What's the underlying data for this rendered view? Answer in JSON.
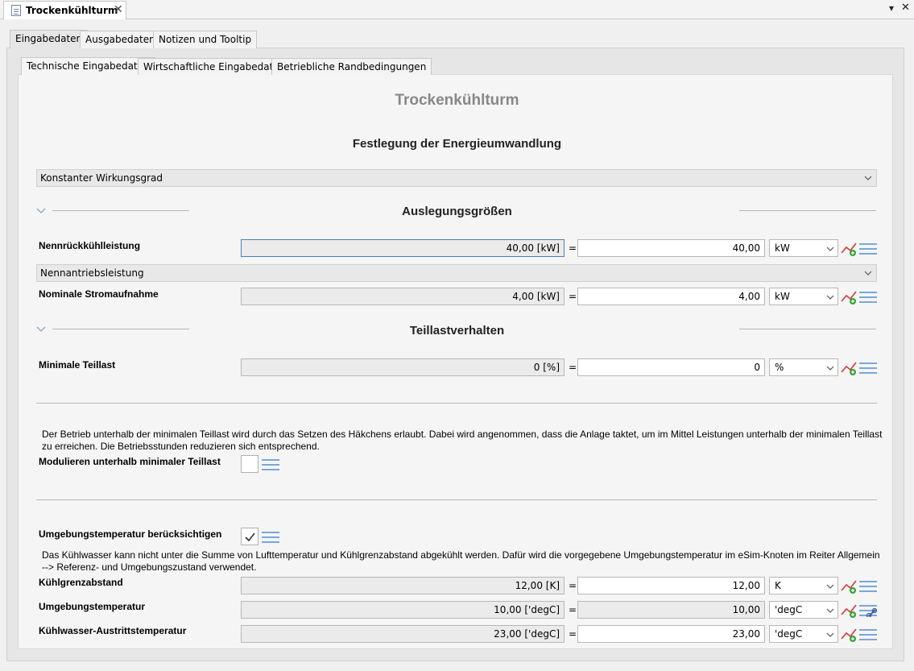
{
  "editor": {
    "tab_title": "Trockenkühlturm",
    "close_glyph": "✕",
    "menu_glyph": "▾",
    "win_close_glyph": "✕"
  },
  "tabs": [
    {
      "label": "Eingabedaten",
      "active": true
    },
    {
      "label": "Ausgabedaten",
      "active": false
    },
    {
      "label": "Notizen und Tooltip",
      "active": false
    }
  ],
  "subtabs": [
    {
      "label": "Technische Eingabedaten",
      "active": true
    },
    {
      "label": "Wirtschaftliche Eingabedaten",
      "active": false
    },
    {
      "label": "Betriebliche Randbedingungen",
      "active": false
    }
  ],
  "page_title": "Trockenkühlturm",
  "energy": {
    "heading": "Festlegung der Energieumwandlung",
    "mode_value": "Konstanter Wirkungsgrad"
  },
  "design": {
    "heading": "Auslegungsgrößen",
    "nenn_label": "Nennrückkühlleistung",
    "nenn_readonly": "40,00 [kW]",
    "nenn_value": "40,00",
    "nenn_unit": "kW",
    "drive_mode": "Nennantriebsleistung",
    "strom_label": "Nominale Stromaufnahme",
    "strom_readonly": "4,00 [kW]",
    "strom_value": "4,00",
    "strom_unit": "kW"
  },
  "partload": {
    "heading": "Teillastverhalten",
    "min_label": "Minimale Teillast",
    "min_readonly": "0 [%]",
    "min_value": "0",
    "min_unit": "%"
  },
  "modulate": {
    "description": "Der Betrieb unterhalb der minimalen Teillast wird durch das Setzen des Häkchens erlaubt. Dabei wird angenommen, dass die Anlage taktet, um im Mittel Leistungen unterhalb der minimalen Teillast zu erreichen. Die Betriebsstunden reduzieren sich entsprechend.",
    "label": "Modulieren unterhalb minimaler Teillast",
    "checked": false
  },
  "ambient": {
    "label": "Umgebungstemperatur berücksichtigen",
    "checked": true,
    "description": "Das Kühlwasser kann nicht unter die Summe von Lufttemperatur und Kühlgrenzabstand abgekühlt werden. Dafür wird die vorgegebene Umgebungstemperatur im eSim-Knoten im Reiter Allgemein --> Referenz- und Umgebungszustand verwendet.",
    "rows": [
      {
        "label": "Kühlgrenzabstand",
        "readonly": "12,00 [K]",
        "value": "12,00",
        "unit": "K",
        "linked": false
      },
      {
        "label": "Umgebungstemperatur",
        "readonly": "10,00 ['degC]",
        "value": "10,00",
        "unit": "'degC",
        "linked": true
      },
      {
        "label": "Kühlwasser-Austrittstemperatur",
        "readonly": "23,00 ['degC]",
        "value": "23,00",
        "unit": "'degC",
        "linked": false
      }
    ]
  },
  "equals": "=",
  "icons": {
    "chart": "chart-curve-add-icon",
    "list": "list-lines-icon",
    "link": "link-icon",
    "check": "check-icon",
    "chevron": "chevron-down-icon"
  },
  "colors": {
    "accent_border": "#4a7fb0",
    "icon_blue": "#7aa7d8",
    "icon_red": "#d23b3b",
    "icon_green": "#3aa33a"
  }
}
